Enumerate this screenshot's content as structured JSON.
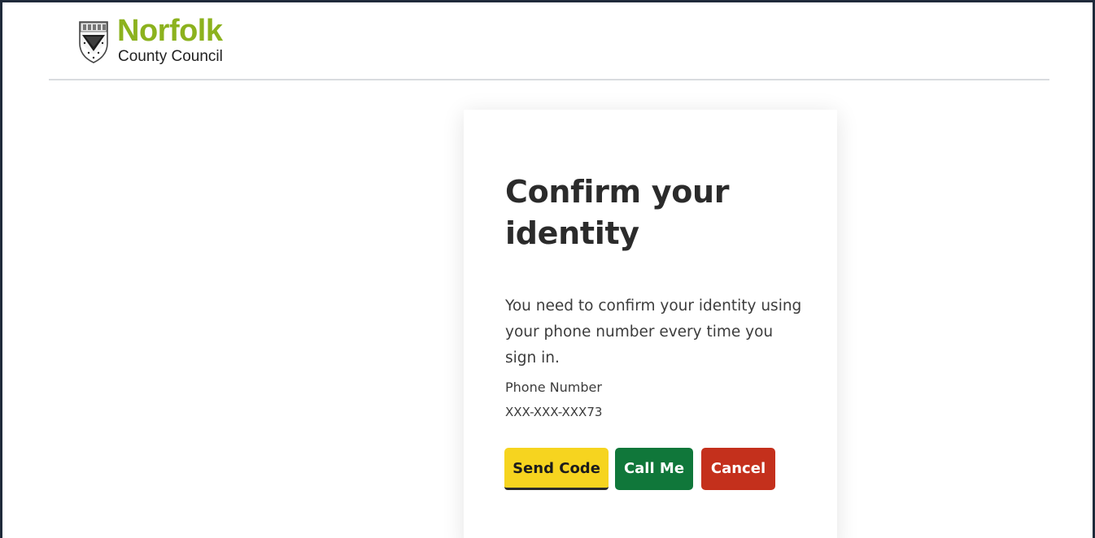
{
  "brand": {
    "name": "Norfolk",
    "subtitle": "County Council",
    "name_color": "#8cb21e"
  },
  "icons": {
    "crest": "norfolk-crest-icon"
  },
  "card": {
    "title": "Confirm your identity",
    "description": "You need to confirm your identity using your phone number every time you sign in.",
    "phone_label": "Phone Number",
    "phone_value": "XXX-XXX-XXX73"
  },
  "buttons": {
    "send_code": "Send Code",
    "call_me": "Call Me",
    "cancel": "Cancel"
  },
  "colors": {
    "send_code_bg": "#f6d41f",
    "call_me_bg": "#10773a",
    "cancel_bg": "#c4301c",
    "frame_border": "#1f2a3a"
  }
}
